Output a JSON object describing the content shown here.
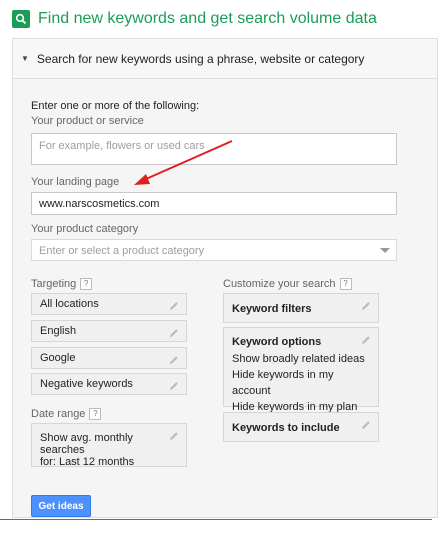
{
  "header": {
    "icon": "search-icon",
    "title": "Find new keywords and get search volume data"
  },
  "section": {
    "title": "Search for new keywords using a phrase, website or category"
  },
  "form": {
    "intro": "Enter one or more of the following:",
    "product": {
      "label": "Your product or service",
      "placeholder": "For example, flowers or used cars"
    },
    "landing": {
      "label": "Your landing page",
      "value": "www.narscosmetics.com"
    },
    "category": {
      "label": "Your product category",
      "placeholder": "Enter or select a product category"
    }
  },
  "targeting": {
    "label": "Targeting",
    "help": "?",
    "items": [
      "All locations",
      "English",
      "Google",
      "Negative keywords"
    ]
  },
  "date_range": {
    "label": "Date range",
    "help": "?",
    "text_line1": "Show avg. monthly searches",
    "text_line2": "for: Last 12 months"
  },
  "customize": {
    "label": "Customize your search",
    "help": "?",
    "keyword_filters": "Keyword filters",
    "keyword_options": {
      "title": "Keyword options",
      "lines": [
        "Show broadly related ideas",
        "Hide keywords in my account",
        "Hide keywords in my plan"
      ]
    },
    "keywords_to_include": "Keywords to include"
  },
  "actions": {
    "get_ideas": "Get ideas"
  },
  "colors": {
    "brand_green": "#1a9e55",
    "button_blue": "#4d90fe",
    "annotation_red": "#e0201e"
  }
}
